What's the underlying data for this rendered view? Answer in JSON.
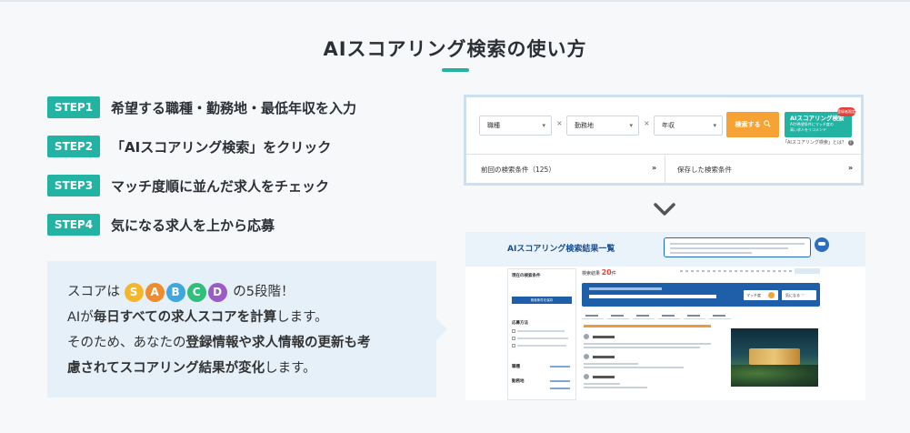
{
  "heading": "AIスコアリング検索の使い方",
  "steps": [
    {
      "badge": "STEP1",
      "text": "希望する職種・勤務地・最低年収を入力"
    },
    {
      "badge": "STEP2",
      "text": "「AIスコアリング検索」をクリック"
    },
    {
      "badge": "STEP3",
      "text": "マッチ度順に並んだ求人をチェック"
    },
    {
      "badge": "STEP4",
      "text": "気になる求人を上から応募"
    }
  ],
  "info": {
    "line1_pre": "スコアは",
    "grades": [
      {
        "letter": "S",
        "color": "#f5b72a"
      },
      {
        "letter": "A",
        "color": "#f18c2e"
      },
      {
        "letter": "B",
        "color": "#3ea7e0"
      },
      {
        "letter": "C",
        "color": "#2fbf7a"
      },
      {
        "letter": "D",
        "color": "#9b5bc8"
      }
    ],
    "line1_post": "の5段階！",
    "line2_pre": "AIが",
    "line2_bold": "毎日すべての求人スコアを計算",
    "line2_post": "します。",
    "line3_pre": "そのため、あなたの",
    "line3_bold": "登録情報や求人情報の更新も考",
    "line4_bold": "慮されてスコアリング結果が変化",
    "line4_post": "します。"
  },
  "search_panel": {
    "job_select": "職種",
    "location_select": "勤務地",
    "salary_select": "年収",
    "search_button": "検索する",
    "ai_button_title": "AIスコアリング検索",
    "ai_button_sub1": "AIが希望条件にマッチ度の",
    "ai_button_sub2": "高い求人をリコメンド",
    "new_badge": "登録者限定",
    "ai_help": "「AIスコアリング検索」とは？",
    "previous_conditions": "前回の検索条件（125）",
    "saved_conditions": "保存した検索条件"
  },
  "results_panel": {
    "title": "AIスコアリング検索結果一覧",
    "current_conditions": "現在の検索条件",
    "save_conditions_button": "検索条件を保存",
    "apply_method": "応募方法",
    "occupation": "職種",
    "workplace": "勤務地",
    "count_label": "検索結果",
    "count_value": "20",
    "count_unit": "件",
    "match_button": "マッチ度",
    "fav_button": "気になる"
  },
  "colors": {
    "accent_teal": "#22b3a3",
    "search_orange": "#f7a234",
    "results_blue": "#1f5ea8"
  }
}
